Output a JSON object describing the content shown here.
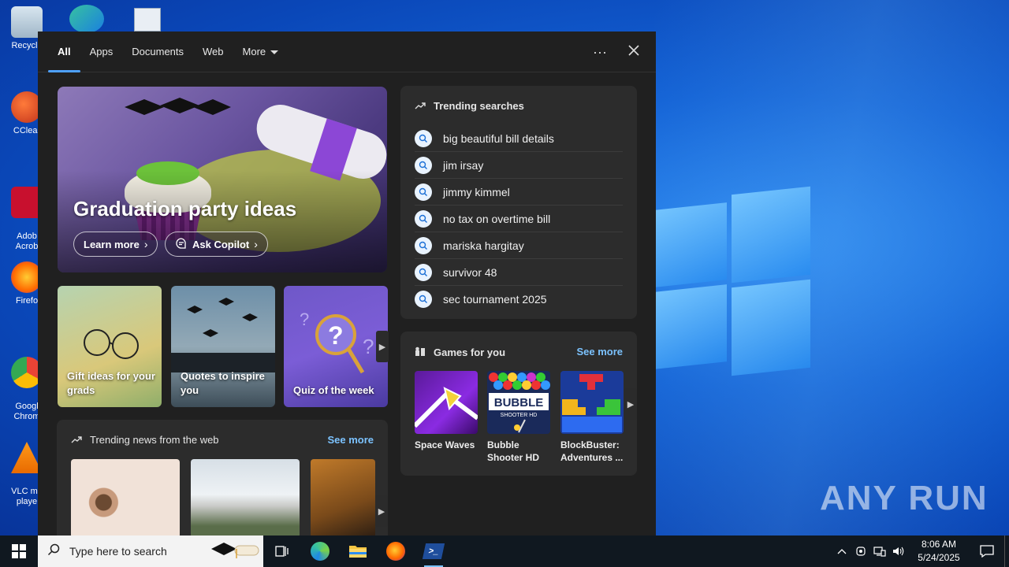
{
  "desktop": {
    "icons": [
      {
        "label": "Recycle"
      },
      {
        "label": "CClear"
      },
      {
        "label": "Adob\nAcrob"
      },
      {
        "label": "Firefo"
      },
      {
        "label": "Googl\nChrom"
      },
      {
        "label": "VLC me\nplaye"
      }
    ],
    "watermark": "ANY RUN"
  },
  "search_panel": {
    "tabs": [
      {
        "label": "All",
        "active": true
      },
      {
        "label": "Apps"
      },
      {
        "label": "Documents"
      },
      {
        "label": "Web"
      },
      {
        "label": "More"
      }
    ],
    "more_options_icon": "ellipsis-icon",
    "close_icon": "close-icon",
    "hero": {
      "title": "Graduation party ideas",
      "learn_more": "Learn more",
      "ask_copilot": "Ask Copilot"
    },
    "tiles": [
      {
        "label": "Gift ideas for your grads"
      },
      {
        "label": "Quotes to inspire you"
      },
      {
        "label": "Quiz of the week"
      }
    ],
    "trending_news": {
      "title": "Trending news from the web",
      "see_more": "See more"
    },
    "trending_searches": {
      "title": "Trending searches",
      "items": [
        "big beautiful bill details",
        "jim irsay",
        "jimmy kimmel",
        "no tax on overtime bill",
        "mariska hargitay",
        "survivor 48",
        "sec tournament 2025"
      ]
    },
    "games": {
      "title": "Games for you",
      "see_more": "See more",
      "items": [
        {
          "name": "Space Waves"
        },
        {
          "name": "Bubble Shooter HD"
        },
        {
          "name": "BlockBuster: Adventures ..."
        }
      ],
      "bubble_art_text": "BUBBLE SHOOTER HD"
    }
  },
  "taskbar": {
    "search_placeholder": "Type here to search",
    "clock_time": "8:06 AM",
    "clock_date": "5/24/2025"
  },
  "colors": {
    "accent": "#4ea1ff",
    "link": "#7cc3ff",
    "panel_bg": "#202020",
    "card_bg": "#2c2c2c"
  }
}
